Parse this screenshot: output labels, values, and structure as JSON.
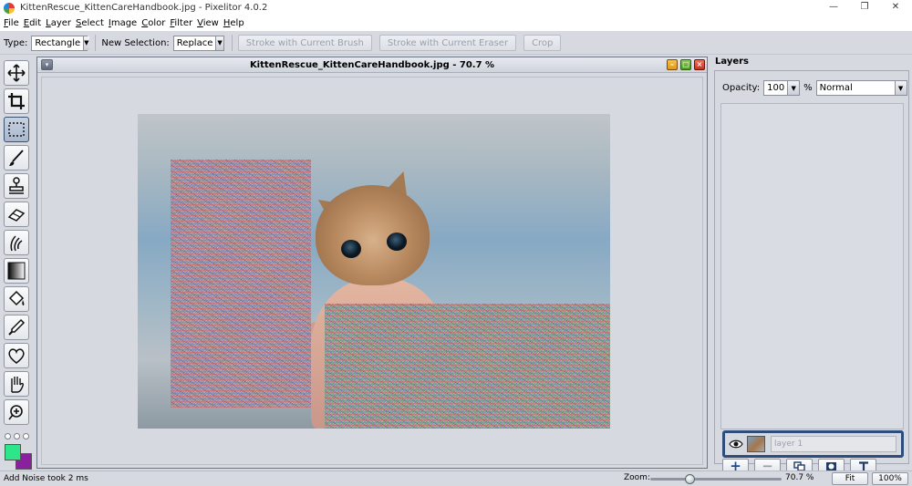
{
  "window": {
    "title": "KittenRescue_KittenCareHandbook.jpg - Pixelitor 4.0.2",
    "minimize_glyph": "—",
    "restore_glyph": "❐",
    "close_glyph": "✕"
  },
  "menu": [
    {
      "accel": "F",
      "rest": "ile"
    },
    {
      "accel": "E",
      "rest": "dit"
    },
    {
      "accel": "L",
      "rest": "ayer"
    },
    {
      "accel": "S",
      "rest": "elect"
    },
    {
      "accel": "I",
      "rest": "mage"
    },
    {
      "accel": "C",
      "rest": "olor"
    },
    {
      "accel": "F",
      "rest": "ilter"
    },
    {
      "accel": "V",
      "rest": "iew"
    },
    {
      "accel": "H",
      "rest": "elp"
    }
  ],
  "toolbar": {
    "type_label": "Type:",
    "type_value": "Rectangle",
    "new_selection_label": "New Selection:",
    "new_selection_value": "Replace",
    "stroke_brush_label": "Stroke with Current Brush",
    "stroke_eraser_label": "Stroke with Current Eraser",
    "crop_label": "Crop"
  },
  "tools": [
    {
      "name": "move-tool",
      "icon": "move-icon",
      "selected": false
    },
    {
      "name": "crop-tool",
      "icon": "crop-icon",
      "selected": false
    },
    {
      "name": "selection-tool",
      "icon": "marquee-icon",
      "selected": true
    },
    {
      "name": "brush-tool",
      "icon": "brush-icon",
      "selected": false
    },
    {
      "name": "clone-stamp-tool",
      "icon": "stamp-icon",
      "selected": false
    },
    {
      "name": "eraser-tool",
      "icon": "eraser-icon",
      "selected": false
    },
    {
      "name": "smudge-tool",
      "icon": "smudge-icon",
      "selected": false
    },
    {
      "name": "gradient-tool",
      "icon": "gradient-icon",
      "selected": false
    },
    {
      "name": "paint-bucket-tool",
      "icon": "bucket-icon",
      "selected": false
    },
    {
      "name": "color-picker-tool",
      "icon": "eyedropper-icon",
      "selected": false
    },
    {
      "name": "shapes-tool",
      "icon": "heart-icon",
      "selected": false
    },
    {
      "name": "hand-tool",
      "icon": "hand-icon",
      "selected": false
    },
    {
      "name": "zoom-tool",
      "icon": "zoom-icon",
      "selected": false
    }
  ],
  "colors": {
    "foreground": "#2ee68a",
    "background": "#8a1fa0"
  },
  "document": {
    "title": "KittenRescue_KittenCareHandbook.jpg - 70.7 %",
    "menu_glyph": "▾"
  },
  "layers": {
    "header": "Layers",
    "opacity_label": "Opacity:",
    "opacity_value": "100",
    "percent_sign": "%",
    "blend_mode": "Normal",
    "items": [
      {
        "name": "layer 1",
        "visible": true
      }
    ],
    "buttons": {
      "add": "+",
      "delete": "−"
    }
  },
  "status": {
    "message": "Add Noise took 2 ms",
    "zoom_label": "Zoom:",
    "zoom_value": "70.7 %",
    "zoom_slider_fraction": 0.3,
    "fit_label": "Fit",
    "actual_label": "100%"
  }
}
